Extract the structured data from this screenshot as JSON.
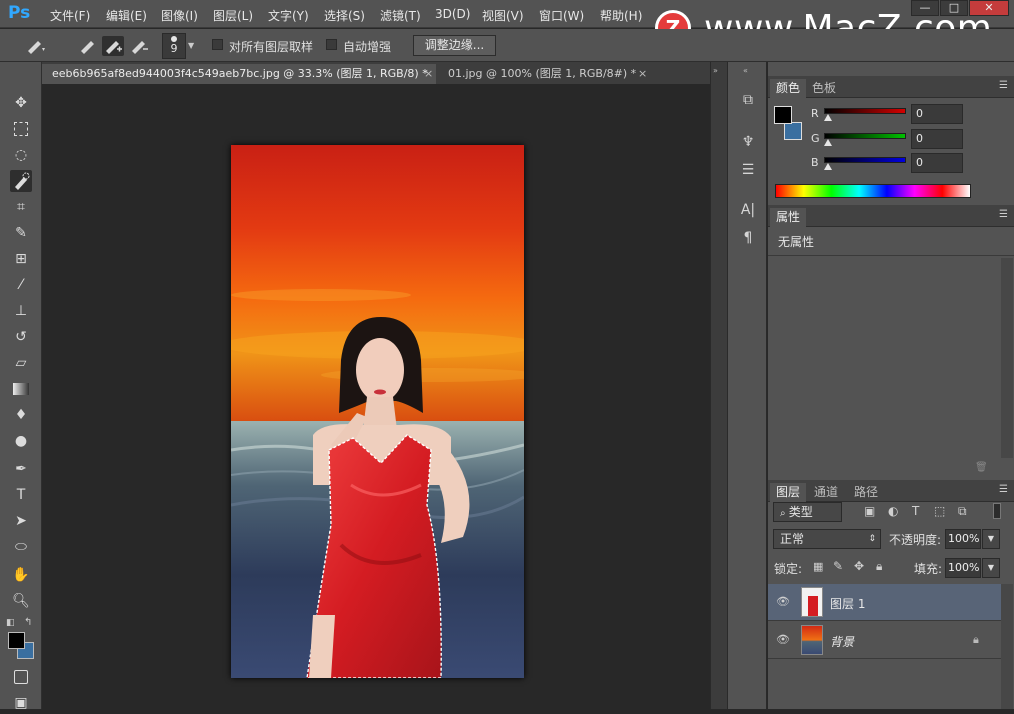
{
  "app": {
    "logo": "Ps"
  },
  "menu": [
    "文件(F)",
    "编辑(E)",
    "图像(I)",
    "图层(L)",
    "文字(Y)",
    "选择(S)",
    "滤镜(T)",
    "3D(D)",
    "视图(V)",
    "窗口(W)",
    "帮助(H)"
  ],
  "window_controls": {
    "minimize": "—",
    "maximize": "□",
    "close": "✕"
  },
  "watermark": {
    "badge": "Z",
    "text": "www.MacZ.com"
  },
  "options": {
    "brush_size": "9",
    "sample_all_layers": "对所有图层取样",
    "auto_enhance": "自动增强",
    "refine_edge": "调整边缘..."
  },
  "tabs": [
    {
      "label": "eeb6b965af8ed944003f4c549aeb7bc.jpg @ 33.3% (图层 1, RGB/8) *",
      "close": "×"
    },
    {
      "label": "01.jpg @ 100% (图层 1, RGB/8#) *",
      "close": "×"
    }
  ],
  "color_panel": {
    "tabs": [
      "颜色",
      "色板"
    ],
    "channels": [
      {
        "label": "R",
        "value": "0",
        "color": "#c80000"
      },
      {
        "label": "G",
        "value": "0",
        "color": "#00b000"
      },
      {
        "label": "B",
        "value": "0",
        "color": "#0000d0"
      }
    ],
    "foreground": "#000000",
    "background": "#3a6fa0"
  },
  "properties_panel": {
    "tab": "属性",
    "text": "无属性"
  },
  "layers_panel": {
    "tabs": [
      "图层",
      "通道",
      "路径"
    ],
    "filter": "类型",
    "blend_mode": "正常",
    "opacity_label": "不透明度:",
    "opacity": "100%",
    "lock_label": "锁定:",
    "fill_label": "填充:",
    "fill": "100%",
    "layers": [
      {
        "name": "图层 1",
        "selected": true
      },
      {
        "name": "背景",
        "selected": false,
        "locked": true
      }
    ]
  }
}
